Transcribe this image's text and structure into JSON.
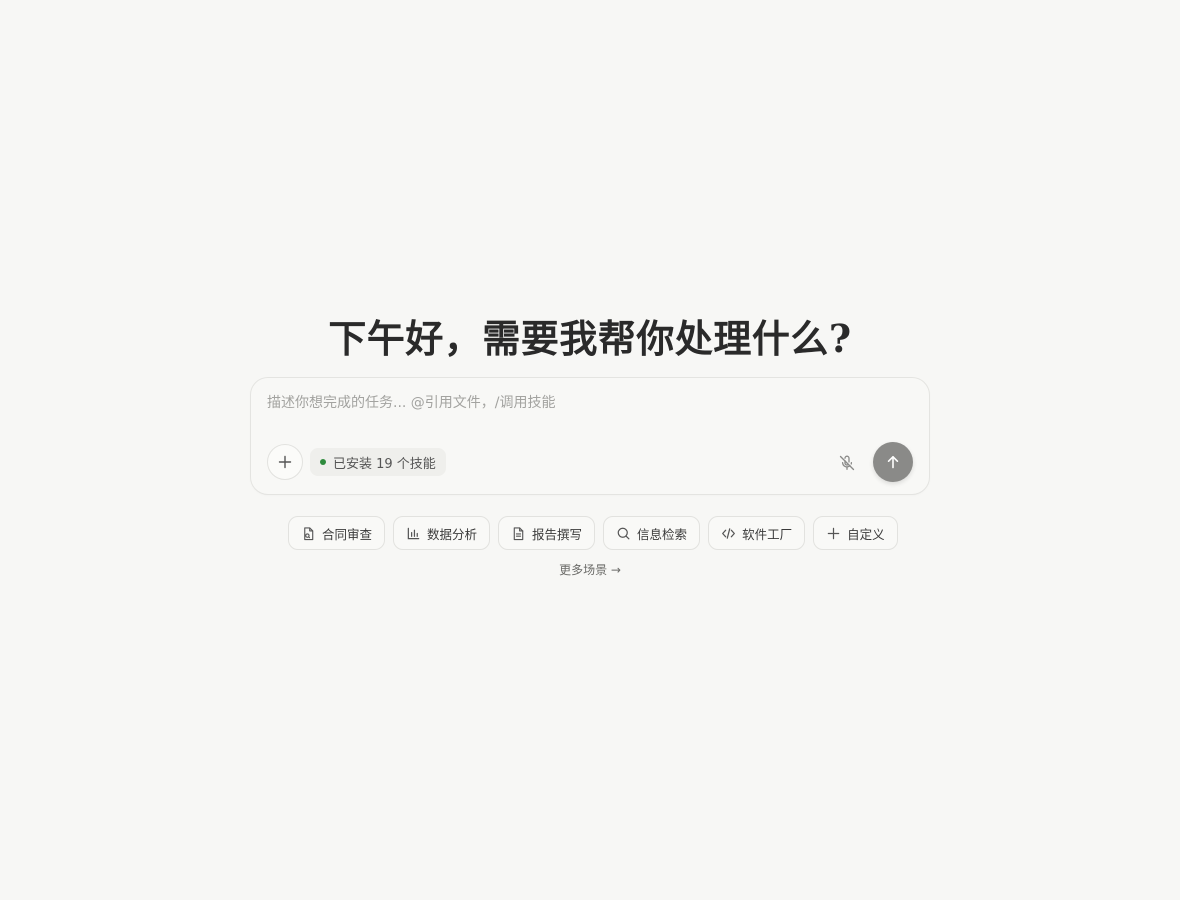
{
  "greeting": "下午好，需要我帮你处理什么?",
  "composer": {
    "placeholder": "描述你想完成的任务... @引用文件，/调用技能",
    "value": "",
    "skills_badge": "已安装 19 个技能"
  },
  "chips": [
    {
      "label": "合同审查",
      "icon": "contract-doc-icon"
    },
    {
      "label": "数据分析",
      "icon": "bar-chart-icon"
    },
    {
      "label": "报告撰写",
      "icon": "document-icon"
    },
    {
      "label": "信息检索",
      "icon": "search-icon"
    },
    {
      "label": "软件工厂",
      "icon": "code-icon"
    },
    {
      "label": "自定义",
      "icon": "plus-icon"
    }
  ],
  "more_link": "更多场景 →",
  "colors": {
    "background": "#f7f7f5",
    "send_button": "#8a8a88",
    "status_dot": "#2e8b3d"
  }
}
